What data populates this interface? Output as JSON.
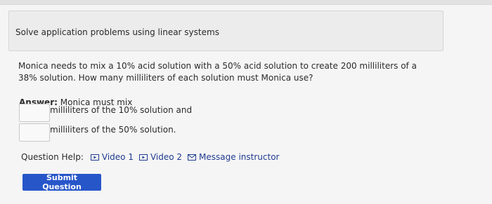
{
  "header": {
    "title": "Solve application problems using linear systems"
  },
  "problem": {
    "text": "Monica needs to mix a 10% acid solution with a 50% acid solution to create 200 milliliters of a 38% solution. How many milliliters of each solution must Monica use?"
  },
  "answer": {
    "label": "Answer:",
    "intro": "Monica must mix",
    "field1": {
      "value": "",
      "suffix": "milliliters of the 10% solution and"
    },
    "field2": {
      "value": "",
      "suffix": "milliliters of the 50% solution."
    }
  },
  "help": {
    "label": "Question Help:",
    "links": [
      {
        "label": "Video 1",
        "icon": "play-icon"
      },
      {
        "label": "Video 2",
        "icon": "play-icon"
      },
      {
        "label": "Message instructor",
        "icon": "envelope-icon"
      }
    ]
  },
  "submit": {
    "label": "Submit Question"
  },
  "colors": {
    "accent": "#2756c9",
    "link": "#1f3b8f"
  }
}
